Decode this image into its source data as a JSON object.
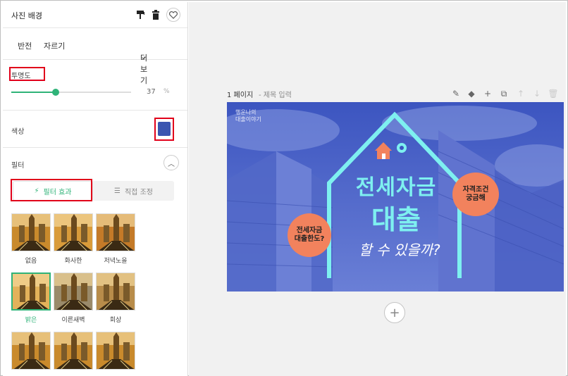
{
  "panel": {
    "title": "사진 배경",
    "tabs": {
      "flip": "반전",
      "crop": "자르기",
      "more": "더보기"
    },
    "opacity": {
      "label": "투명도",
      "value": "37",
      "unit": "%",
      "level": 0.37
    },
    "color": {
      "label": "색상",
      "swatch": "#3a55b0"
    },
    "filter": {
      "label": "필터",
      "tab_effect": "필터 효과",
      "tab_manual": "직접 조정",
      "items": [
        "없음",
        "화사한",
        "저녁노을",
        "밝은",
        "이른새벽",
        "회상",
        "",
        "",
        ""
      ],
      "selected": "밝은"
    }
  },
  "canvas": {
    "page_label": "1 페이지",
    "title_placeholder": "- 제목 입력"
  },
  "design": {
    "headline": "전세자금",
    "headline2": "대출",
    "subline": "할 수 있을까?",
    "bubble_left": "전세자금\n대출한도?",
    "bubble_right": "자격조건\n궁금해",
    "logo_text": "행운나의\n대출이야기"
  },
  "colors": {
    "accent": "#2fb378",
    "highlight": "#e1001a",
    "sky": "#4a63c7",
    "mint": "#7ef0f0",
    "bubble": "#f2825d"
  }
}
